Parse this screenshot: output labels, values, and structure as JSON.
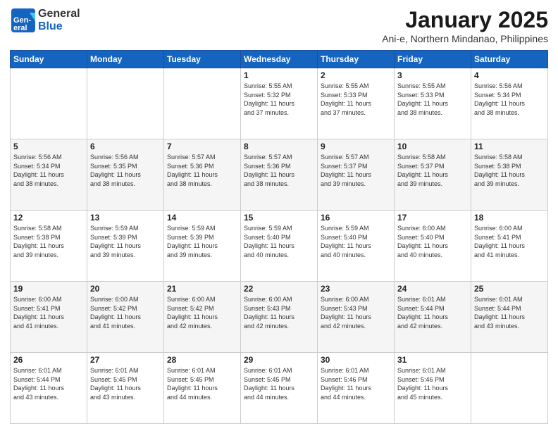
{
  "logo": {
    "general": "General",
    "blue": "Blue"
  },
  "title": "January 2025",
  "subtitle": "Ani-e, Northern Mindanao, Philippines",
  "days_header": [
    "Sunday",
    "Monday",
    "Tuesday",
    "Wednesday",
    "Thursday",
    "Friday",
    "Saturday"
  ],
  "weeks": [
    [
      {
        "day": "",
        "info": ""
      },
      {
        "day": "",
        "info": ""
      },
      {
        "day": "",
        "info": ""
      },
      {
        "day": "1",
        "info": "Sunrise: 5:55 AM\nSunset: 5:32 PM\nDaylight: 11 hours\nand 37 minutes."
      },
      {
        "day": "2",
        "info": "Sunrise: 5:55 AM\nSunset: 5:33 PM\nDaylight: 11 hours\nand 37 minutes."
      },
      {
        "day": "3",
        "info": "Sunrise: 5:55 AM\nSunset: 5:33 PM\nDaylight: 11 hours\nand 38 minutes."
      },
      {
        "day": "4",
        "info": "Sunrise: 5:56 AM\nSunset: 5:34 PM\nDaylight: 11 hours\nand 38 minutes."
      }
    ],
    [
      {
        "day": "5",
        "info": "Sunrise: 5:56 AM\nSunset: 5:34 PM\nDaylight: 11 hours\nand 38 minutes."
      },
      {
        "day": "6",
        "info": "Sunrise: 5:56 AM\nSunset: 5:35 PM\nDaylight: 11 hours\nand 38 minutes."
      },
      {
        "day": "7",
        "info": "Sunrise: 5:57 AM\nSunset: 5:36 PM\nDaylight: 11 hours\nand 38 minutes."
      },
      {
        "day": "8",
        "info": "Sunrise: 5:57 AM\nSunset: 5:36 PM\nDaylight: 11 hours\nand 38 minutes."
      },
      {
        "day": "9",
        "info": "Sunrise: 5:57 AM\nSunset: 5:37 PM\nDaylight: 11 hours\nand 39 minutes."
      },
      {
        "day": "10",
        "info": "Sunrise: 5:58 AM\nSunset: 5:37 PM\nDaylight: 11 hours\nand 39 minutes."
      },
      {
        "day": "11",
        "info": "Sunrise: 5:58 AM\nSunset: 5:38 PM\nDaylight: 11 hours\nand 39 minutes."
      }
    ],
    [
      {
        "day": "12",
        "info": "Sunrise: 5:58 AM\nSunset: 5:38 PM\nDaylight: 11 hours\nand 39 minutes."
      },
      {
        "day": "13",
        "info": "Sunrise: 5:59 AM\nSunset: 5:39 PM\nDaylight: 11 hours\nand 39 minutes."
      },
      {
        "day": "14",
        "info": "Sunrise: 5:59 AM\nSunset: 5:39 PM\nDaylight: 11 hours\nand 39 minutes."
      },
      {
        "day": "15",
        "info": "Sunrise: 5:59 AM\nSunset: 5:40 PM\nDaylight: 11 hours\nand 40 minutes."
      },
      {
        "day": "16",
        "info": "Sunrise: 5:59 AM\nSunset: 5:40 PM\nDaylight: 11 hours\nand 40 minutes."
      },
      {
        "day": "17",
        "info": "Sunrise: 6:00 AM\nSunset: 5:40 PM\nDaylight: 11 hours\nand 40 minutes."
      },
      {
        "day": "18",
        "info": "Sunrise: 6:00 AM\nSunset: 5:41 PM\nDaylight: 11 hours\nand 41 minutes."
      }
    ],
    [
      {
        "day": "19",
        "info": "Sunrise: 6:00 AM\nSunset: 5:41 PM\nDaylight: 11 hours\nand 41 minutes."
      },
      {
        "day": "20",
        "info": "Sunrise: 6:00 AM\nSunset: 5:42 PM\nDaylight: 11 hours\nand 41 minutes."
      },
      {
        "day": "21",
        "info": "Sunrise: 6:00 AM\nSunset: 5:42 PM\nDaylight: 11 hours\nand 42 minutes."
      },
      {
        "day": "22",
        "info": "Sunrise: 6:00 AM\nSunset: 5:43 PM\nDaylight: 11 hours\nand 42 minutes."
      },
      {
        "day": "23",
        "info": "Sunrise: 6:00 AM\nSunset: 5:43 PM\nDaylight: 11 hours\nand 42 minutes."
      },
      {
        "day": "24",
        "info": "Sunrise: 6:01 AM\nSunset: 5:44 PM\nDaylight: 11 hours\nand 42 minutes."
      },
      {
        "day": "25",
        "info": "Sunrise: 6:01 AM\nSunset: 5:44 PM\nDaylight: 11 hours\nand 43 minutes."
      }
    ],
    [
      {
        "day": "26",
        "info": "Sunrise: 6:01 AM\nSunset: 5:44 PM\nDaylight: 11 hours\nand 43 minutes."
      },
      {
        "day": "27",
        "info": "Sunrise: 6:01 AM\nSunset: 5:45 PM\nDaylight: 11 hours\nand 43 minutes."
      },
      {
        "day": "28",
        "info": "Sunrise: 6:01 AM\nSunset: 5:45 PM\nDaylight: 11 hours\nand 44 minutes."
      },
      {
        "day": "29",
        "info": "Sunrise: 6:01 AM\nSunset: 5:45 PM\nDaylight: 11 hours\nand 44 minutes."
      },
      {
        "day": "30",
        "info": "Sunrise: 6:01 AM\nSunset: 5:46 PM\nDaylight: 11 hours\nand 44 minutes."
      },
      {
        "day": "31",
        "info": "Sunrise: 6:01 AM\nSunset: 5:46 PM\nDaylight: 11 hours\nand 45 minutes."
      },
      {
        "day": "",
        "info": ""
      }
    ]
  ]
}
